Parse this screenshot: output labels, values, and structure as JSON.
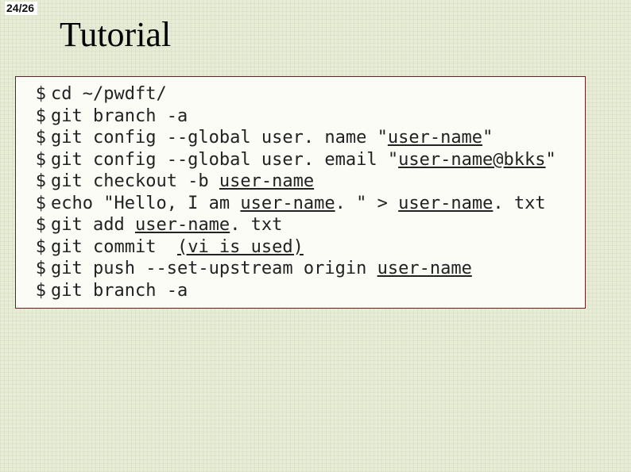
{
  "page_counter": "24/26",
  "title": "Tutorial",
  "prompt": "$",
  "lines": {
    "l0": {
      "pre": "cd ~/pwdft/"
    },
    "l1": {
      "pre": "git branch -a"
    },
    "l2": {
      "pre": "git config --global user. name \"",
      "u": "user-name",
      "post": "\""
    },
    "l3": {
      "pre": "git config --global user. email \"",
      "u": "user-name@bkks",
      "post": "\""
    },
    "l4": {
      "pre": "git checkout -b ",
      "u": "user-name"
    },
    "l5": {
      "pre": "echo \"Hello, I am ",
      "u": "user-name",
      "mid": ". \" > ",
      "u2": "user-name",
      "post": ". txt"
    },
    "l6": {
      "pre": "git add ",
      "u": "user-name",
      "post": ". txt"
    },
    "l7": {
      "pre": "git commit  ",
      "u": "(vi is used)"
    },
    "l8": {
      "pre": "git push --set-upstream origin ",
      "u": "user-name"
    },
    "l9": {
      "pre": "git branch -a"
    }
  }
}
